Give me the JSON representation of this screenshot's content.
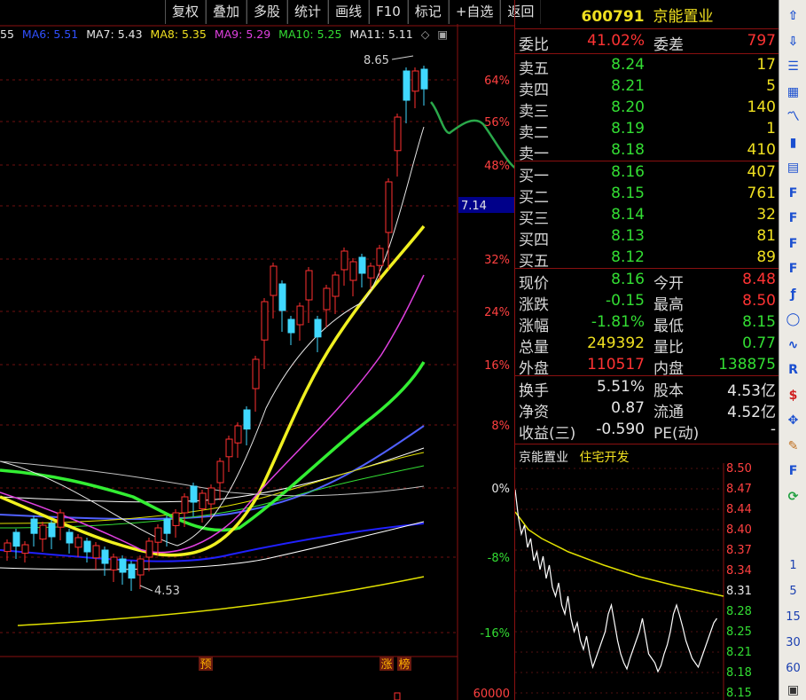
{
  "toolbar": {
    "items": [
      "复权",
      "叠加",
      "多股",
      "统计",
      "画线",
      "F10",
      "标记",
      "+自选",
      "返回"
    ]
  },
  "ma_legend": [
    {
      "text": "55",
      "color": "#e6e6e6"
    },
    {
      "text": "MA6: 5.51",
      "color": "#3050ff"
    },
    {
      "text": "MA7: 5.43",
      "color": "#e6e6e6"
    },
    {
      "text": "MA8: 5.35",
      "color": "#f0e020"
    },
    {
      "text": "MA9: 5.29",
      "color": "#e040e0"
    },
    {
      "text": "MA10: 5.25",
      "color": "#33dd33"
    },
    {
      "text": "MA11: 5.11",
      "color": "#e6e6e6"
    }
  ],
  "chart": {
    "price_high_label": "8.65",
    "price_low_label": "4.53",
    "current_price_tag": "7.14",
    "pct_axis": [
      "64%",
      "56%",
      "48%",
      "40%",
      "32%",
      "24%",
      "16%",
      "8%",
      "0%",
      "-8%",
      "-16%"
    ],
    "volume_label": "60000",
    "markers": [
      "预",
      "涨",
      "榜"
    ]
  },
  "stock": {
    "code": "600791",
    "name": "京能置业"
  },
  "weibi": {
    "label": "委比",
    "value": "41.02%",
    "label2": "委差",
    "value2": "797"
  },
  "asks": [
    {
      "label": "卖五",
      "price": "8.24",
      "vol": "17"
    },
    {
      "label": "卖四",
      "price": "8.21",
      "vol": "5"
    },
    {
      "label": "卖三",
      "price": "8.20",
      "vol": "140"
    },
    {
      "label": "卖二",
      "price": "8.19",
      "vol": "1"
    },
    {
      "label": "卖一",
      "price": "8.18",
      "vol": "410"
    }
  ],
  "bids": [
    {
      "label": "买一",
      "price": "8.16",
      "vol": "407"
    },
    {
      "label": "买二",
      "price": "8.15",
      "vol": "761"
    },
    {
      "label": "买三",
      "price": "8.14",
      "vol": "32"
    },
    {
      "label": "买四",
      "price": "8.13",
      "vol": "81"
    },
    {
      "label": "买五",
      "price": "8.12",
      "vol": "89"
    }
  ],
  "quote": [
    {
      "l1": "现价",
      "v1": "8.16",
      "c1": "green",
      "l2": "今开",
      "v2": "8.48",
      "c2": "red"
    },
    {
      "l1": "涨跌",
      "v1": "-0.15",
      "c1": "green",
      "l2": "最高",
      "v2": "8.50",
      "c2": "red"
    },
    {
      "l1": "涨幅",
      "v1": "-1.81%",
      "c1": "green",
      "l2": "最低",
      "v2": "8.15",
      "c2": "green"
    },
    {
      "l1": "总量",
      "v1": "249392",
      "c1": "yellow",
      "l2": "量比",
      "v2": "0.77",
      "c2": "green"
    },
    {
      "l1": "外盘",
      "v1": "110517",
      "c1": "red",
      "l2": "内盘",
      "v2": "138875",
      "c2": "green"
    }
  ],
  "fundamentals": [
    {
      "l1": "换手",
      "v1": "5.51%",
      "l2": "股本",
      "v2": "4.53亿"
    },
    {
      "l1": "净资",
      "v1": "0.87",
      "l2": "流通",
      "v2": "4.52亿"
    },
    {
      "l1": "收益(三)",
      "v1": "-0.590",
      "l2": "PE(动)",
      "v2": "-"
    }
  ],
  "mini": {
    "name": "京能置业",
    "sector": "住宅开发",
    "axis": [
      "8.50",
      "8.47",
      "8.44",
      "8.40",
      "8.37",
      "8.34",
      "8.31",
      "8.28",
      "8.25",
      "8.21",
      "8.18",
      "8.15"
    ]
  },
  "sidebar_numbers": [
    "1",
    "5",
    "15",
    "30",
    "60"
  ],
  "sidebar_icons": [
    "arrow-up-icon",
    "arrow-down-icon",
    "list-icon",
    "grid-icon",
    "line-chart-icon",
    "candle-icon",
    "table-icon",
    "f10-icon",
    "f6-icon",
    "f5-icon",
    "f12-icon",
    "fx-icon",
    "circle-icon",
    "wave-icon",
    "rsi-icon",
    "dollar-icon",
    "move-icon",
    "pen-icon",
    "f-icon",
    "refresh-icon"
  ]
}
